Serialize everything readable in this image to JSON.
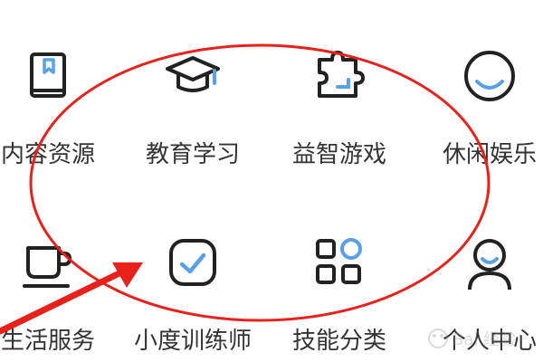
{
  "grid": {
    "items": [
      {
        "label": "内容资源",
        "icon": "book-icon"
      },
      {
        "label": "教育学习",
        "icon": "graduation-cap-icon"
      },
      {
        "label": "益智游戏",
        "icon": "puzzle-icon"
      },
      {
        "label": "休闲娱乐",
        "icon": "smile-icon"
      },
      {
        "label": "生活服务",
        "icon": "cup-icon"
      },
      {
        "label": "小度训练师",
        "icon": "checkbox-icon"
      },
      {
        "label": "技能分类",
        "icon": "categories-icon"
      },
      {
        "label": "个人中心",
        "icon": "person-icon"
      }
    ]
  },
  "annotation": {
    "ellipse_color": "#e8211b",
    "arrow_color": "#e8211b",
    "accent_color": "#5aa0e6"
  },
  "watermark": {
    "text": "Bai 经验"
  }
}
